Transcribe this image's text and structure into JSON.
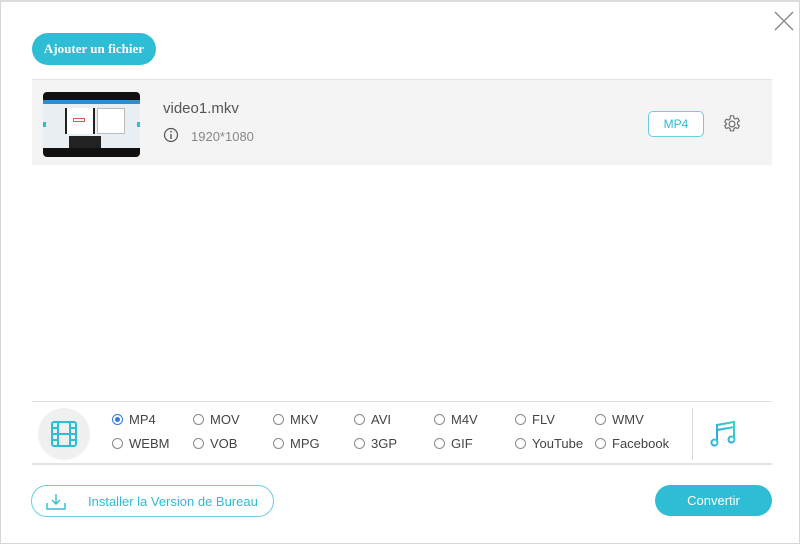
{
  "header": {
    "add_file_label": "Ajouter un fichier",
    "close_icon": "close-icon"
  },
  "file": {
    "name": "video1.mkv",
    "resolution": "1920*1080",
    "output_format": "MP4",
    "info_icon": "info-icon",
    "settings_icon": "gear-icon"
  },
  "formats": {
    "video_tab_icon": "film-icon",
    "audio_tab_icon": "music-note-icon",
    "selected": "MP4",
    "options": [
      {
        "label": "MP4",
        "checked": true
      },
      {
        "label": "MOV",
        "checked": false
      },
      {
        "label": "MKV",
        "checked": false
      },
      {
        "label": "AVI",
        "checked": false
      },
      {
        "label": "M4V",
        "checked": false
      },
      {
        "label": "FLV",
        "checked": false
      },
      {
        "label": "WMV",
        "checked": false
      },
      {
        "label": "WEBM",
        "checked": false
      },
      {
        "label": "VOB",
        "checked": false
      },
      {
        "label": "MPG",
        "checked": false
      },
      {
        "label": "3GP",
        "checked": false
      },
      {
        "label": "GIF",
        "checked": false
      },
      {
        "label": "YouTube",
        "checked": false
      },
      {
        "label": "Facebook",
        "checked": false
      }
    ]
  },
  "footer": {
    "install_label": "Installer la Version de Bureau",
    "convert_label": "Convertir"
  },
  "colors": {
    "accent": "#2ebdd4",
    "radio_selected": "#2f7be5",
    "row_background": "#f4f4f4"
  }
}
